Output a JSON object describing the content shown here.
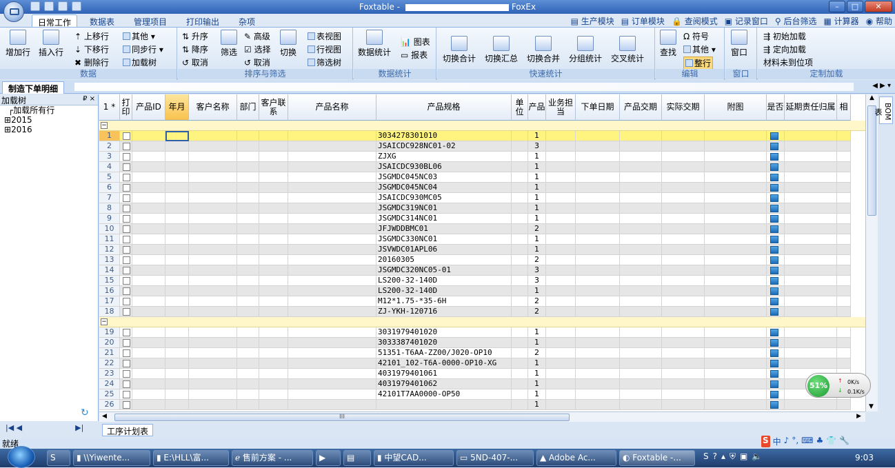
{
  "window": {
    "title_left": "Foxtable - ",
    "title_right": "FoxEx"
  },
  "ribbon_tabs": [
    "日常工作",
    "数据表",
    "管理项目",
    "打印输出",
    "杂项"
  ],
  "top_right_items": [
    "生产模块",
    "订单模块",
    "查阅模式",
    "记录窗口",
    "后台筛选",
    "计算器",
    "帮助"
  ],
  "groups": {
    "data": {
      "label": "数据",
      "add_row": "增加行",
      "insert_row": "插入行",
      "move_up": "上移行",
      "move_down": "下移行",
      "delete_row": "删除行",
      "other": "其他",
      "sync_row": "同步行",
      "load_tree": "加载树"
    },
    "sort": {
      "label": "排序与筛选",
      "asc": "升序",
      "desc": "降序",
      "cancel": "取消",
      "filter": "筛选",
      "advanced": "高级",
      "select": "选择",
      "cancel2": "取消",
      "switch": "切换",
      "table_view": "表视图",
      "row_view": "行视图",
      "filter_tree": "筛选树"
    },
    "stats": {
      "label": "数据统计",
      "data_stats": "数据统计",
      "chart": "图表",
      "report": "报表"
    },
    "quick": {
      "label": "快速统计",
      "sw_total": "切换合计",
      "sw_summary": "切换汇总",
      "sw_merge": "切换合并",
      "group_stats": "分组统计",
      "cross_stats": "交叉统计"
    },
    "edit": {
      "label": "编辑",
      "find": "查找",
      "symbol": "符号",
      "other": "其他",
      "whole_row": "整行"
    },
    "window": {
      "label": "窗口",
      "window": "窗口"
    },
    "custom": {
      "label": "定制加载",
      "init_load": "初始加载",
      "directed_load": "定向加载",
      "material_missing": "材料未到位项"
    }
  },
  "doc_tab": "制造下单明细",
  "tree": {
    "title": "加载树",
    "pin": "₽ ×",
    "items": [
      "加载所有行",
      "2015",
      "2016"
    ]
  },
  "columns": [
    {
      "label": "1 *"
    },
    {
      "label": "打印"
    },
    {
      "label": "产品ID"
    },
    {
      "label": "年月"
    },
    {
      "label": "客户名称"
    },
    {
      "label": "部门"
    },
    {
      "label": "客户联系"
    },
    {
      "label": "产品名称"
    },
    {
      "label": "产品规格"
    },
    {
      "label": "单位"
    },
    {
      "label": "产品"
    },
    {
      "label": "业务担当"
    },
    {
      "label": "下单日期"
    },
    {
      "label": "产品交期"
    },
    {
      "label": "实际交期"
    },
    {
      "label": "附图"
    },
    {
      "label": "是否"
    },
    {
      "label": "延期责任归属"
    },
    {
      "label": "相"
    }
  ],
  "rows_group1": [
    {
      "n": "1",
      "spec": "3034278301010",
      "qty": "1"
    },
    {
      "n": "2",
      "spec": "JSAICDC928NC01-02",
      "qty": "3"
    },
    {
      "n": "3",
      "spec": "ZJXG",
      "qty": "1"
    },
    {
      "n": "4",
      "spec": "JSAICDC930BL06",
      "qty": "1"
    },
    {
      "n": "5",
      "spec": "JSGMDC045NC03",
      "qty": "1"
    },
    {
      "n": "6",
      "spec": "JSGMDC045NC04",
      "qty": "1"
    },
    {
      "n": "7",
      "spec": "JSAICDC930MC05",
      "qty": "1"
    },
    {
      "n": "8",
      "spec": "JSGMDC319NC01",
      "qty": "1"
    },
    {
      "n": "9",
      "spec": "JSGMDC314NC01",
      "qty": "1"
    },
    {
      "n": "10",
      "spec": "JFJWDDBMC01",
      "qty": "2"
    },
    {
      "n": "11",
      "spec": "JSGMDC330NC01",
      "qty": "1"
    },
    {
      "n": "12",
      "spec": "JSVWDC01APL06",
      "qty": "1"
    },
    {
      "n": "13",
      "spec": "20160305",
      "qty": "2"
    },
    {
      "n": "14",
      "spec": "JSGMDC320NC05-01",
      "qty": "3"
    },
    {
      "n": "15",
      "spec": "LS200-32-140D",
      "qty": "3"
    },
    {
      "n": "16",
      "spec": "LS200-32-140D",
      "qty": "1"
    },
    {
      "n": "17",
      "spec": "M12*1.75-*35-6H",
      "qty": "2"
    },
    {
      "n": "18",
      "spec": "ZJ-YKH-120716",
      "qty": "2"
    }
  ],
  "rows_group2": [
    {
      "n": "19",
      "spec": "3031979401020",
      "qty": "1"
    },
    {
      "n": "20",
      "spec": "3033387401020",
      "qty": "1"
    },
    {
      "n": "21",
      "spec": "51351-T6AA-ZZ00/J020-OP10",
      "qty": "2"
    },
    {
      "n": "22",
      "spec": "42101_102-T6A-0000-OP10-XG",
      "qty": "1"
    },
    {
      "n": "23",
      "spec": "4031979401061",
      "qty": "1"
    },
    {
      "n": "24",
      "spec": "4031979401062",
      "qty": "1"
    },
    {
      "n": "25",
      "spec": "42101T7AA0000-OP50",
      "qty": "1"
    },
    {
      "n": "26",
      "spec": "",
      "qty": "1"
    }
  ],
  "side_tab": "BOM表",
  "sheet_tab": "工序计划表",
  "status": "就绪",
  "net": {
    "percent": "51%",
    "up": "0K/s",
    "down": "0.1K/s"
  },
  "ime": [
    "中",
    "♪",
    "°,",
    "⌨",
    "♣",
    "👕",
    "🔧"
  ],
  "taskbar": {
    "items": [
      "\\\\Yiwente...",
      "E:\\HLL\\富...",
      "售前方案 - ...",
      "",
      "",
      "中望CAD...",
      "5ND-407-...",
      "Adobe Ac...",
      "Foxtable -..."
    ],
    "clock": "9:03"
  }
}
